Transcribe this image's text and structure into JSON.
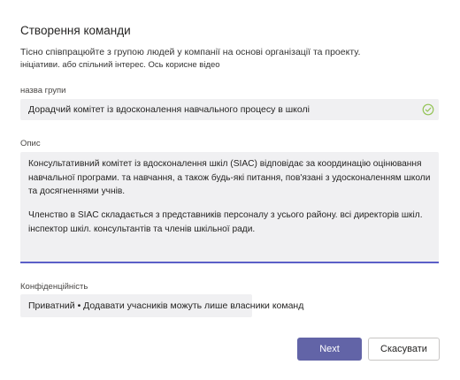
{
  "dialog": {
    "title": "Створення команди",
    "description_line1": "Тісно співпрацюйте з групою людей у компанії на основі організації та проекту.",
    "description_line2": "ініціативи. або спільний інтерес. Ось корисне відео"
  },
  "team_name": {
    "label": "назва групи",
    "value": "Дорадчий комітет із вдосконалення навчального процесу в школі",
    "status_icon": "check-circle-icon"
  },
  "description": {
    "label": "Опис",
    "paragraph1": "Консультативний комітет із вдосконалення шкіл (SIAC) відповідає за координацію оцінювання навчальної програми. та навчання, а також будь-які питання, пов'язані з удосконаленням школи та досягненнями учнів.",
    "paragraph2": "Членство в SIAC складається з представників персоналу з усього району. всі директорів шкіл. інспектор шкіл. консультантів та членів шкільної ради."
  },
  "privacy": {
    "label": "Конфіденційність",
    "value": "Приватний • Додавати учасників можуть лише власники команд"
  },
  "buttons": {
    "next": "Next",
    "cancel": "Скасувати"
  },
  "colors": {
    "accent": "#6264a7",
    "focus_underline": "#5b5fc7",
    "success_check": "#92c353"
  }
}
